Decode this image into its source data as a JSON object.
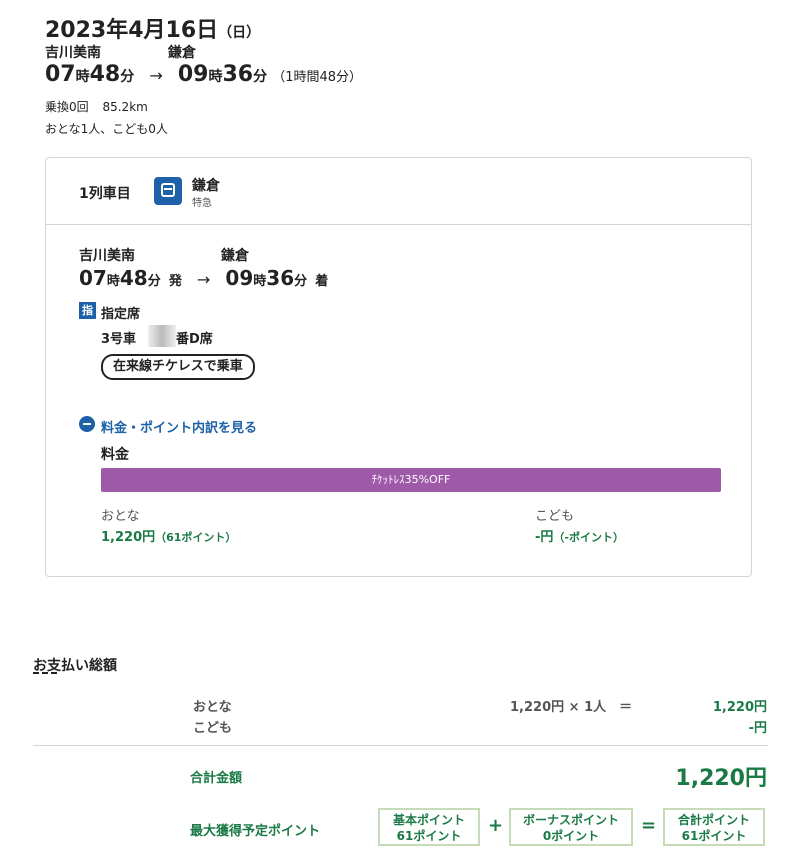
{
  "header": {
    "date": "2023年4月16日",
    "weekday": "（日）",
    "from_station": "吉川美南",
    "to_station": "鎌倉",
    "dep_hour": "07",
    "dep_min": "48",
    "arr_hour": "09",
    "arr_min": "36",
    "hour_unit": "時",
    "min_unit": "分",
    "arrow": "→",
    "duration": "（1時間48分）",
    "transfers": "乗換0回",
    "distance": "85.2km",
    "passengers": "おとな1人、こども0人"
  },
  "card": {
    "car_label": "1列車目",
    "train_name": "鎌倉",
    "train_type": "特急",
    "from_station": "吉川美南",
    "to_station": "鎌倉",
    "dep_hour": "07",
    "dep_min": "48",
    "arr_hour": "09",
    "arr_min": "36",
    "hour_unit": "時",
    "min_unit": "分",
    "dep_suffix": "発",
    "arr_suffix": "着",
    "arrow": "→",
    "seat_badge": "指",
    "seat_class": "指定席",
    "car_no": "3号車",
    "seat_suffix": "番D席",
    "ticketless": "在来線チケレスで乗車",
    "breakdown_link": "料金・ポイント内訳を見る",
    "fare_label": "料金",
    "discount_label": "ﾁｹｯﾄﾚｽ35%OFF",
    "adult_label": "おとな",
    "adult_price": "1,220円",
    "adult_points": "（61ポイント）",
    "child_label": "こども",
    "child_price": "-円",
    "child_points": "（-ポイント）"
  },
  "payment": {
    "title": "お支払い総額",
    "adult_label": "おとな",
    "adult_calc": "1,220円 × 1人　＝",
    "adult_total": "1,220円",
    "child_label": "こども",
    "child_total": "-円",
    "total_label": "合計金額",
    "total_value": "1,220円",
    "points_label": "最大獲得予定ポイント",
    "base_points_label": "基本ポイント",
    "base_points_value": "61ポイント",
    "bonus_points_label": "ボーナスポイント",
    "bonus_points_value": "0ポイント",
    "sum_points_label": "合計ポイント",
    "sum_points_value": "61ポイント",
    "plus": "+",
    "equals": "="
  },
  "colors": {
    "accent_blue": "#1d62a8",
    "price_green": "#1a7a45",
    "discount_purple": "#9e59a8"
  }
}
